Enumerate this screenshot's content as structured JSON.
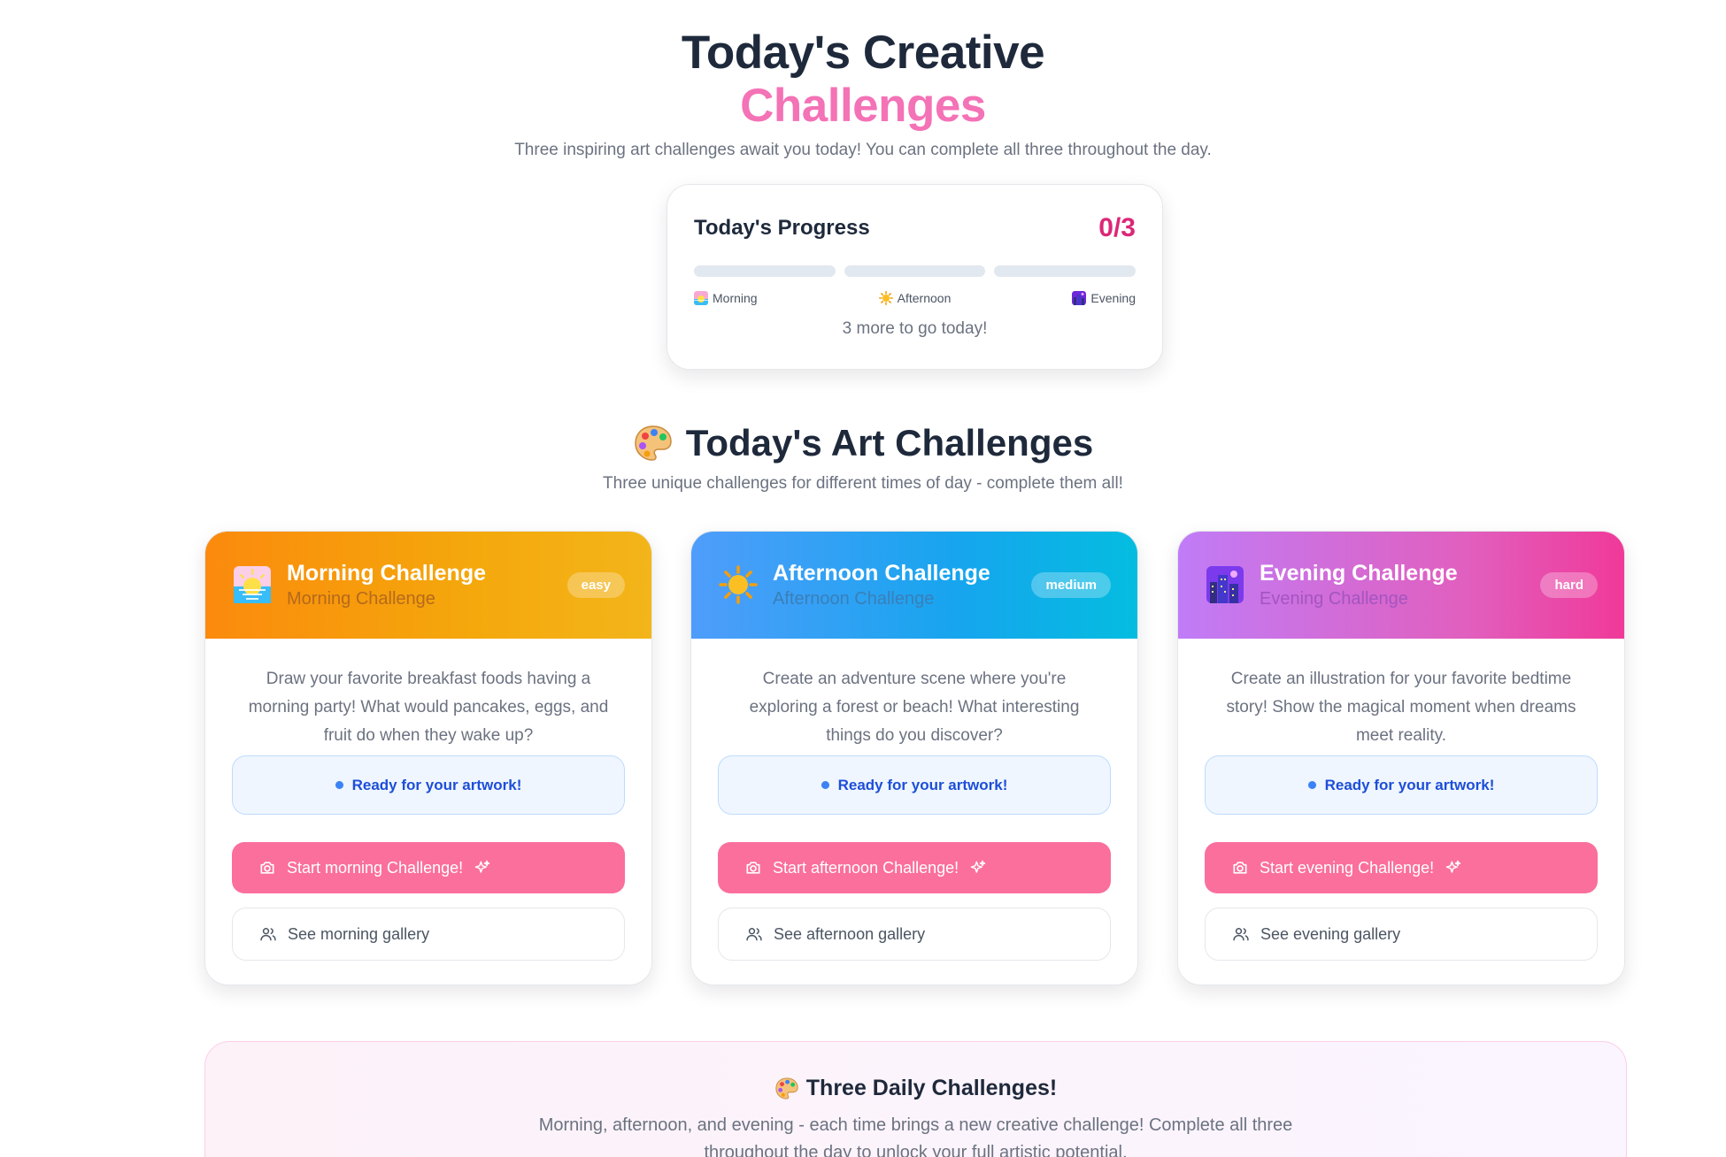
{
  "hero": {
    "title_line1": "Today's Creative",
    "title_line2": "Challenges",
    "subtitle": "Three inspiring art challenges await you today! You can complete all three throughout the day."
  },
  "progress": {
    "title": "Today's Progress",
    "count": "0/3",
    "completed": 0,
    "total": 3,
    "segments": [
      {
        "label": "Morning",
        "icon": "sunrise-icon",
        "filled": 0
      },
      {
        "label": "Afternoon",
        "icon": "sun-icon",
        "filled": 0
      },
      {
        "label": "Evening",
        "icon": "night-city-icon",
        "filled": 0
      }
    ],
    "footer": "3 more to go today!"
  },
  "section": {
    "icon": "palette-icon",
    "title": "Today's Art Challenges",
    "subtitle": "Three unique challenges for different times of day - complete them all!"
  },
  "challenges": [
    {
      "id": "morning",
      "icon": "sunrise-icon",
      "title": "Morning Challenge",
      "subtitle": "Morning Challenge",
      "difficulty": "easy",
      "description": "Draw your favorite breakfast foods having a morning party! What would pancakes, eggs, and fruit do when they wake up?",
      "status": "Ready for your artwork!",
      "start_label": "Start morning Challenge!",
      "gallery_label": "See morning gallery"
    },
    {
      "id": "afternoon",
      "icon": "sun-icon",
      "title": "Afternoon Challenge",
      "subtitle": "Afternoon Challenge",
      "difficulty": "medium",
      "description": "Create an adventure scene where you're exploring a forest or beach! What interesting things do you discover?",
      "status": "Ready for your artwork!",
      "start_label": "Start afternoon Challenge!",
      "gallery_label": "See afternoon gallery"
    },
    {
      "id": "evening",
      "icon": "night-city-icon",
      "title": "Evening Challenge",
      "subtitle": "Evening Challenge",
      "difficulty": "hard",
      "description": "Create an illustration for your favorite bedtime story! Show the magical moment when dreams meet reality.",
      "status": "Ready for your artwork!",
      "start_label": "Start evening Challenge!",
      "gallery_label": "See evening gallery"
    }
  ],
  "banner": {
    "icon": "palette-icon",
    "title": "Three Daily Challenges!",
    "text": "Morning, afternoon, and evening - each time brings a new creative challenge! Complete all three throughout the day to unlock your full artistic potential."
  },
  "colors": {
    "accent_pink": "#f472b6",
    "count_pink": "#db2777",
    "button_pink": "#fb6f9c",
    "status_blue": "#1d4ed8"
  }
}
